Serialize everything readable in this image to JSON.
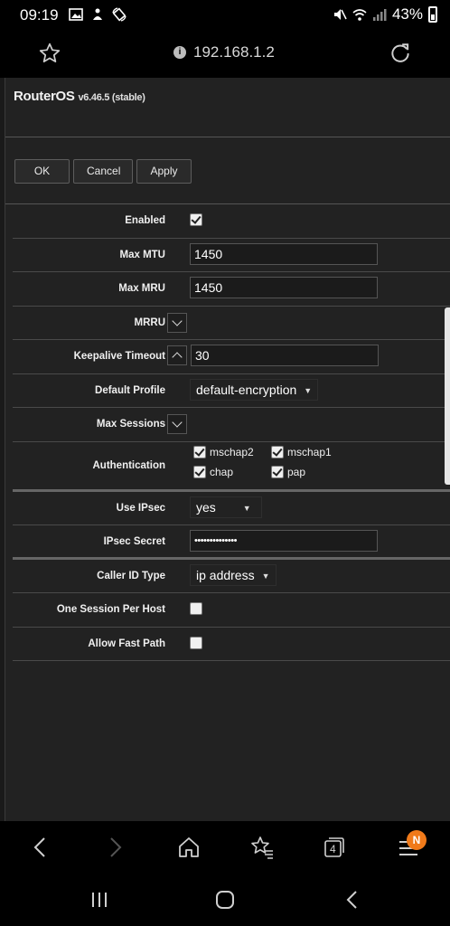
{
  "status_bar": {
    "time": "09:19",
    "battery": "43%",
    "icons": [
      "gallery-icon",
      "pin-icon",
      "rotate-lock-icon",
      "mute-icon",
      "wifi-icon",
      "signal-icon",
      "battery-icon"
    ]
  },
  "browser": {
    "url": "192.168.1.2",
    "icons": [
      "bookmark-star-icon",
      "info-icon",
      "reload-icon"
    ]
  },
  "header": {
    "brand": "RouterOS",
    "version": "v6.46.5 (stable)"
  },
  "toolbar": {
    "ok_label": "OK",
    "cancel_label": "Cancel",
    "apply_label": "Apply"
  },
  "form": {
    "enabled": {
      "label": "Enabled",
      "checked": true
    },
    "max_mtu": {
      "label": "Max MTU",
      "value": "1450"
    },
    "max_mru": {
      "label": "Max MRU",
      "value": "1450"
    },
    "mrru": {
      "label": "MRRU"
    },
    "keepalive": {
      "label": "Keepalive Timeout",
      "value": "30"
    },
    "default_profile": {
      "label": "Default Profile",
      "value": "default-encryption"
    },
    "max_sessions": {
      "label": "Max Sessions"
    },
    "authentication": {
      "label": "Authentication",
      "options": [
        {
          "name": "mschap2",
          "checked": true
        },
        {
          "name": "mschap1",
          "checked": true
        },
        {
          "name": "chap",
          "checked": true
        },
        {
          "name": "pap",
          "checked": true
        }
      ]
    },
    "use_ipsec": {
      "label": "Use IPsec",
      "value": "yes"
    },
    "ipsec_secret": {
      "label": "IPsec Secret",
      "value": "••••••••••••••"
    },
    "caller_id_type": {
      "label": "Caller ID Type",
      "value": "ip address"
    },
    "one_session_per_host": {
      "label": "One Session Per Host",
      "checked": false
    },
    "allow_fast_path": {
      "label": "Allow Fast Path",
      "checked": false
    }
  },
  "bottom_nav": {
    "tabs_count": "4",
    "menu_badge": "N"
  },
  "colors": {
    "background": "#222222",
    "badge": "#f07a1a"
  }
}
